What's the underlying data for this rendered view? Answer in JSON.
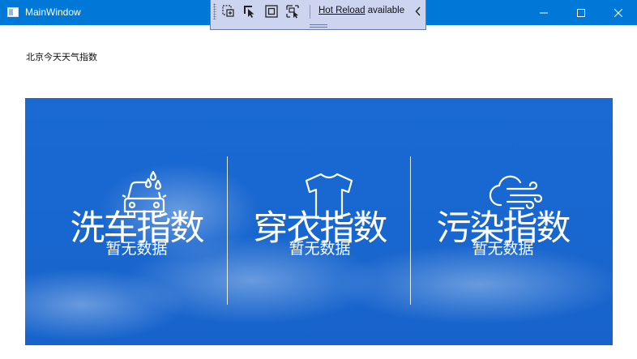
{
  "window": {
    "title": "MainWindow",
    "controls": {
      "minimize": "minimize-icon",
      "maximize": "maximize-icon",
      "close": "close-icon"
    }
  },
  "hot_reload_toolbar": {
    "icons": [
      "select-element-icon",
      "select-cursor-icon",
      "display-layout-icon",
      "track-focus-icon"
    ],
    "link_label": "Hot Reload",
    "status_text": " available",
    "collapse_icon": "chevron-left-icon"
  },
  "page": {
    "heading": "北京今天天气指数"
  },
  "weather_indices": [
    {
      "icon": "car-wash-icon",
      "title": "洗车指数",
      "value": "暂无数据"
    },
    {
      "icon": "tshirt-icon",
      "title": "穿衣指数",
      "value": "暂无数据"
    },
    {
      "icon": "cloud-wind-icon",
      "title": "污染指数",
      "value": "暂无数据"
    }
  ],
  "colors": {
    "titlebar": "#0078d7",
    "panel": "#1a6ad4",
    "toolbar": "#cdd4ef",
    "text_on_panel": "#ffffff"
  }
}
